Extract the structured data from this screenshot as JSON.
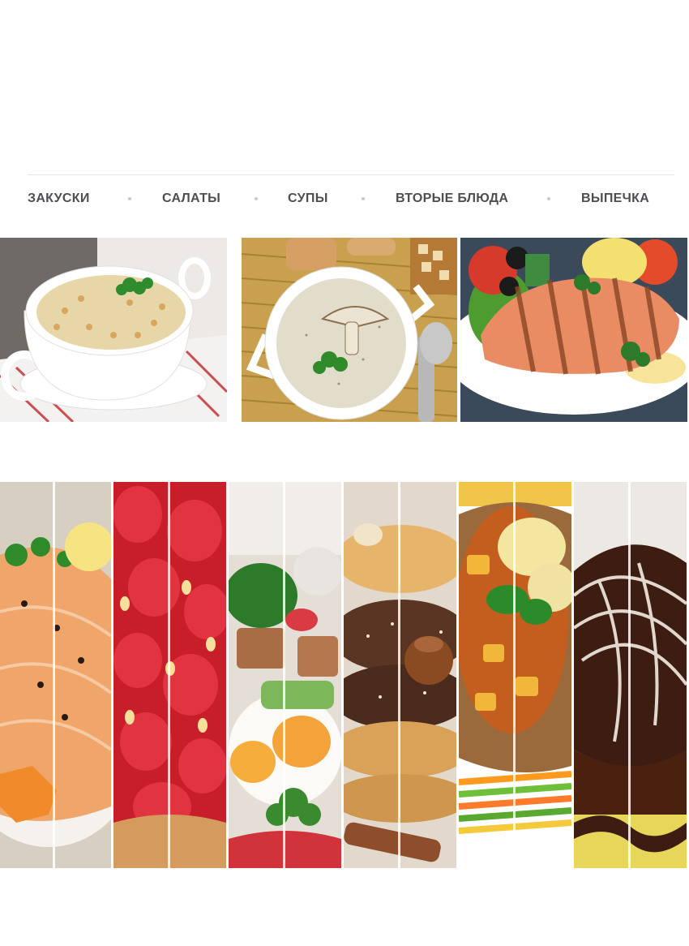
{
  "nav": {
    "items": [
      {
        "label": "ЗАКУСКИ"
      },
      {
        "label": "САЛАТЫ"
      },
      {
        "label": "СУПЫ"
      },
      {
        "label": "ВТОРЫЕ БЛЮДА"
      },
      {
        "label": "ВЫПЕЧКА"
      }
    ]
  },
  "photos": [
    {
      "name": "porridge-photo"
    },
    {
      "name": "mushroom-soup-photo"
    },
    {
      "name": "grilled-salmon-photo"
    }
  ],
  "collage": {
    "strips": [
      {
        "name": "salmon-strip"
      },
      {
        "name": "strawberry-tart-strip"
      },
      {
        "name": "egg-salad-strip"
      },
      {
        "name": "sesame-cookies-strip"
      },
      {
        "name": "vegetable-stew-strip"
      },
      {
        "name": "chocolate-dessert-strip"
      }
    ]
  },
  "colors": {
    "nav_text": "#4a4f55",
    "rule": "#e6e6e6"
  }
}
